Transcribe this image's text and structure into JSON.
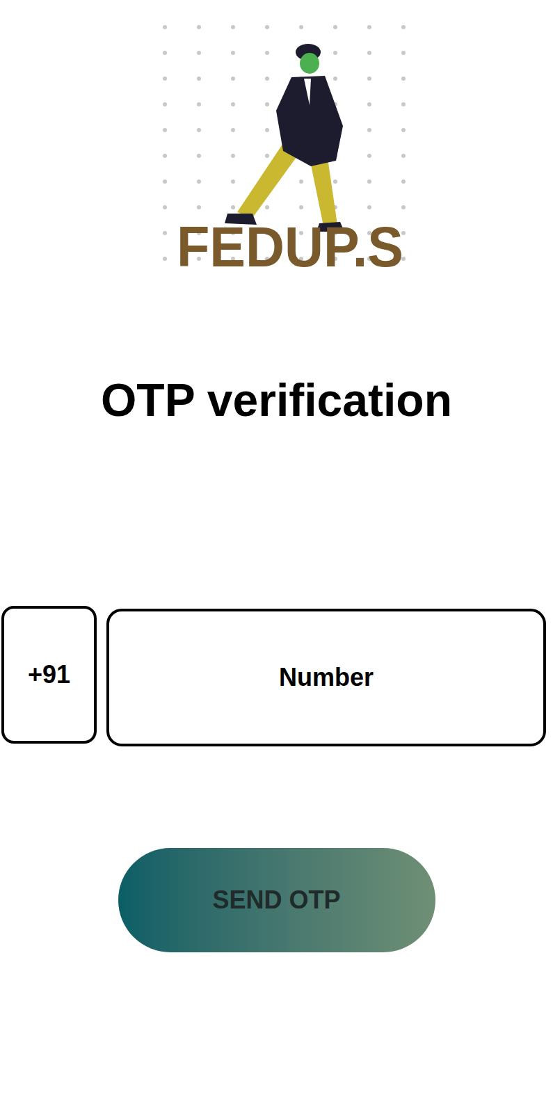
{
  "logo": {
    "text": "FEDUP.S"
  },
  "heading": "OTP verification",
  "phone": {
    "country_code": "+91",
    "placeholder": "Number"
  },
  "button": "SEND OTP"
}
